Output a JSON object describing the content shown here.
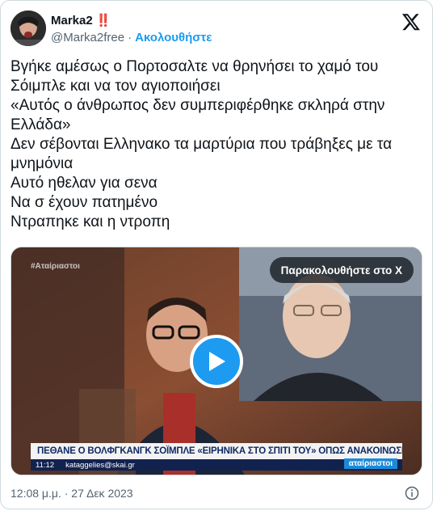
{
  "author": {
    "display_name": "Marka2",
    "badge": "‼️",
    "handle": "@Marka2free",
    "separator": "·",
    "follow_label": "Ακολουθήστε"
  },
  "tweet": {
    "text": "Βγήκε αμέσως ο Πορτοσαλτε να θρηνήσει το χαμό του Σόιμπλε και να τον αγιοποιήσει\n«Αυτός ο άνθρωπος δεν συμπεριφέρθηκε σκληρά στην Ελλάδα»\nΔεν σέβονται Ελληνακο τα μαρτύρια που τράβηξες με τα μνημόνια\nΑυτό ηθελαν για σενα\nΝα σ έχουν πατημένο\nΝτραπηκε και η ντροπη"
  },
  "media": {
    "watch_label": "Παρακολουθήστε στο X",
    "channel_watermark": "#Αταίριαστοι",
    "lower_third": "ΠΕΘΑΝΕ Ο ΒΟΛΦΓΚΑΝΓΚ ΣΟΪΜΠΛΕ «ΕΙΡΗΝΙΚΑ ΣΤΟ ΣΠΙΤΙ ΤΟΥ» ΟΠΩΣ ΑΝΑΚΟΙΝΩΣΕ Η ΟΙΚΟΓΕΝΕΙΑ ΤΟΥ",
    "ticker_time": "11:12",
    "ticker_email": "kataggelies@skai.gr",
    "ticker_brand": "αταίριαστοι"
  },
  "footer": {
    "timestamp": "12:08 μ.μ. · 27 Δεκ 2023"
  },
  "colors": {
    "accent": "#1d9bf0",
    "text": "#0f1419",
    "secondary": "#536471",
    "border": "#cfd9de"
  },
  "icons": {
    "logo": "x-logo-icon",
    "play": "play-icon",
    "info": "info-icon"
  }
}
